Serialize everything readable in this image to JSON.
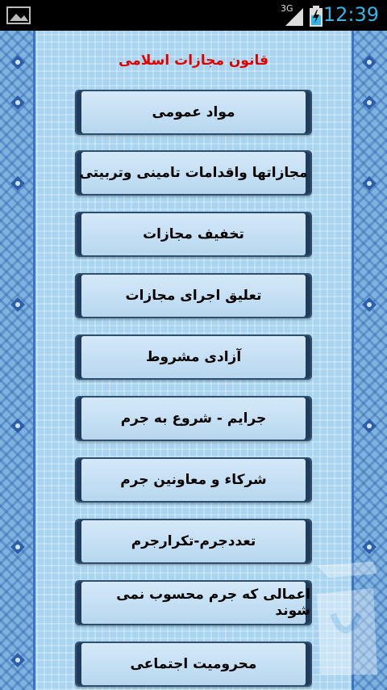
{
  "status_bar": {
    "network": "3G",
    "clock": "12:39"
  },
  "app": {
    "title": "قانون مجازات اسلامی"
  },
  "menu": {
    "items": [
      {
        "label": "مواد عمومی"
      },
      {
        "label": "مجازاتها واقدامات تامینی وتربیتی"
      },
      {
        "label": "تخفیف مجازات"
      },
      {
        "label": "تعلیق اجرای مجازات"
      },
      {
        "label": "آزادی مشروط"
      },
      {
        "label": "جرایم - شروع به جرم"
      },
      {
        "label": "شرکاء و معاونین جرم"
      },
      {
        "label": "تعددجرم-تکرارجرم"
      },
      {
        "label": "اعمالی که جرم محسوب نمی شوند"
      },
      {
        "label": "محرومیت اجتماعی"
      }
    ]
  },
  "colors": {
    "title": "#e00000",
    "clock": "#35b5e5",
    "button_border": "#2f4f6f"
  },
  "icons": {
    "notification": "notification-image-icon",
    "signal": "signal-icon",
    "battery": "battery-charging-icon",
    "watermark": "cafebazaar-logo-icon"
  }
}
